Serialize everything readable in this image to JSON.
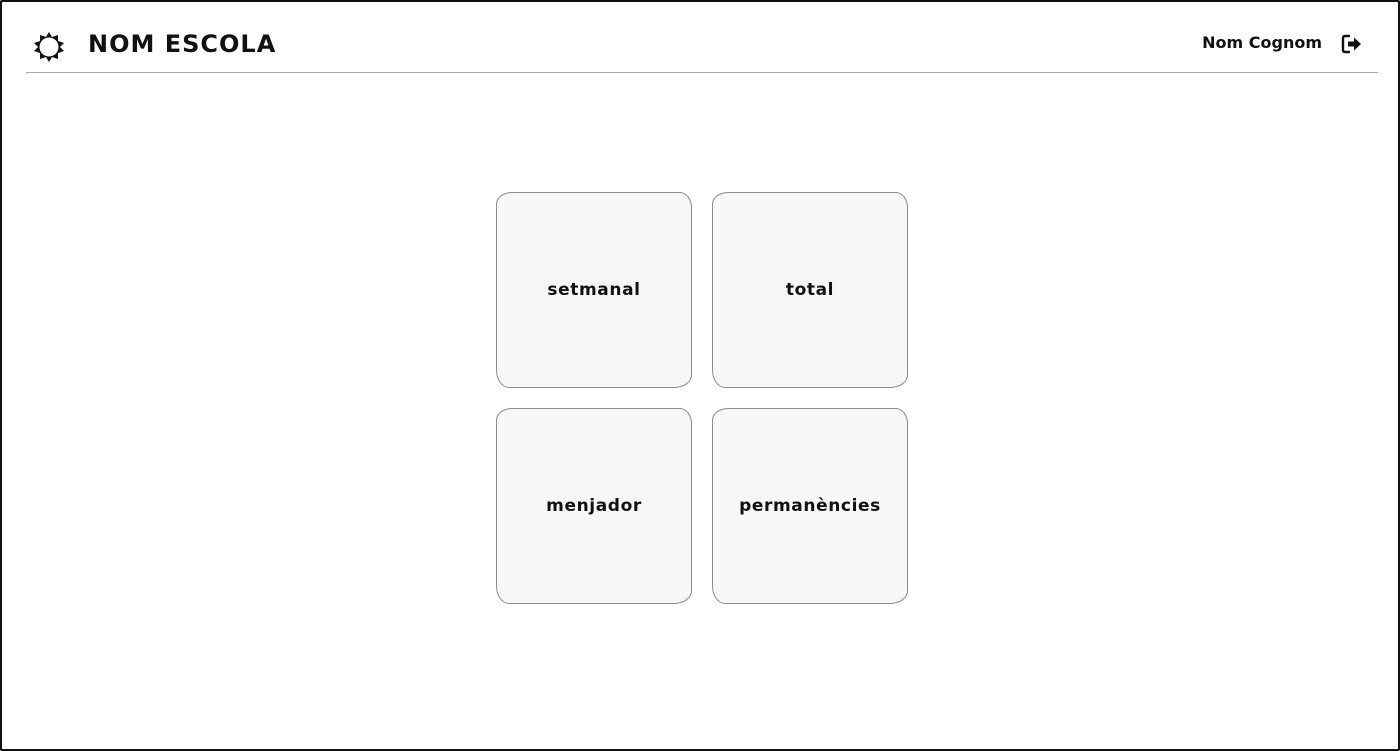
{
  "header": {
    "brand": "NOM ESCOLA",
    "logo_icon": "sun-gear-icon",
    "user_name": "Nom Cognom",
    "logout_icon": "logout-arrow-icon"
  },
  "tiles": [
    {
      "label": "setmanal"
    },
    {
      "label": "total"
    },
    {
      "label": "menjador"
    },
    {
      "label": "permanències"
    }
  ],
  "colors": {
    "text": "#111111",
    "tile_bg": "#f7f7f7",
    "tile_border": "#8a8a8a",
    "divider": "#a8a8a8"
  }
}
